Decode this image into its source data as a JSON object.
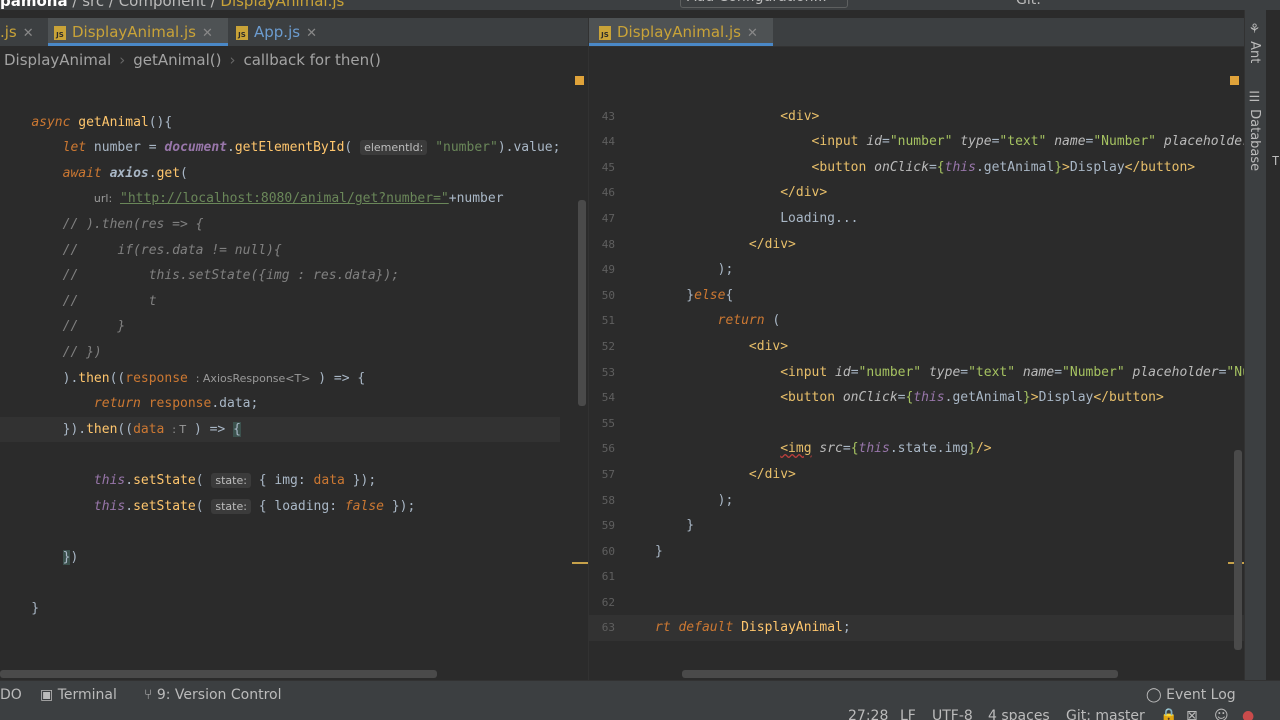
{
  "title_bar": {
    "project": "pamona",
    "path_src": "src",
    "path_component": "Component",
    "path_file": "DisplayAnimal.js",
    "add_configuration": "Add Configuration...",
    "git_label": "Git:"
  },
  "left_tabs": [
    {
      "label": ".js"
    },
    {
      "label": "DisplayAnimal.js"
    },
    {
      "label": "App.js"
    }
  ],
  "right_tabs": [
    {
      "label": "DisplayAnimal.js"
    }
  ],
  "breadcrumb": [
    "DisplayAnimal",
    "getAnimal()",
    "callback for then()"
  ],
  "right_line_numbers": [
    "43",
    "44",
    "45",
    "46",
    "47",
    "48",
    "49",
    "50",
    "51",
    "52",
    "53",
    "54",
    "55",
    "56",
    "57",
    "58",
    "59",
    "60",
    "61",
    "62",
    "63"
  ],
  "side_tools": {
    "ant": "Ant",
    "database": "Database",
    "edge_letter": "T"
  },
  "tool_windows": {
    "todo": "DO",
    "terminal": "Terminal",
    "version_control": "9: Version Control",
    "event_log": "Event Log"
  },
  "status": {
    "position": "27:28",
    "line_sep": "LF",
    "encoding": "UTF-8",
    "indent": "4 spaces",
    "branch": "Git: master"
  },
  "colors": {
    "accent": "#4a88c7",
    "marker": "#e0a33a",
    "js_file": "#c9a338"
  }
}
